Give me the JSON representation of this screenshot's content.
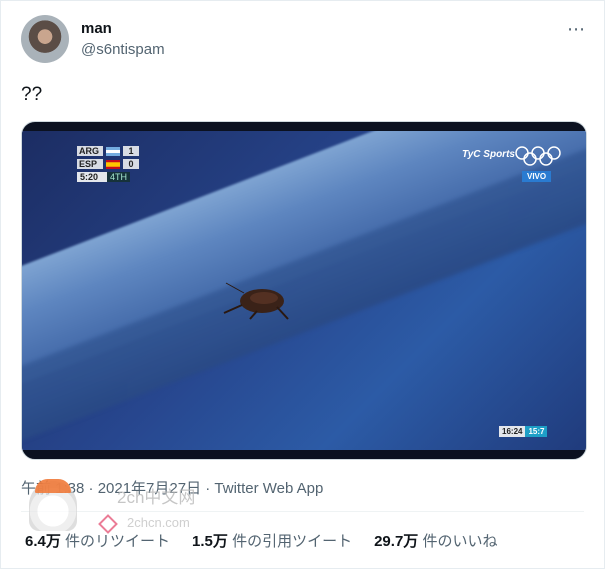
{
  "tweet": {
    "author_name": "man",
    "author_handle": "@s6ntispam",
    "more_icon": "more-dots-icon",
    "text": "??",
    "timestamp": "午前 1:38 · 2021年7月27日 · Twitter Web App",
    "stats": [
      {
        "value": "6.4万",
        "label": "件のリツイート"
      },
      {
        "value": "1.5万",
        "label": "件の引用ツイート"
      },
      {
        "value": "29.7万",
        "label": "件のいいね"
      }
    ]
  },
  "video_overlay": {
    "scoreboard": [
      {
        "team": "ARG",
        "score": "1",
        "flag": "argentina-flag"
      },
      {
        "team": "ESP",
        "score": "0",
        "flag": "spain-flag"
      }
    ],
    "game_time": "5:20",
    "period": "4TH",
    "broadcaster": "TyC Sports",
    "live_label": "VIVO",
    "clock_left": "16:24",
    "clock_right": "15:7"
  },
  "watermark": {
    "line1": "2ch中文网",
    "line2": "2chcn.com"
  }
}
